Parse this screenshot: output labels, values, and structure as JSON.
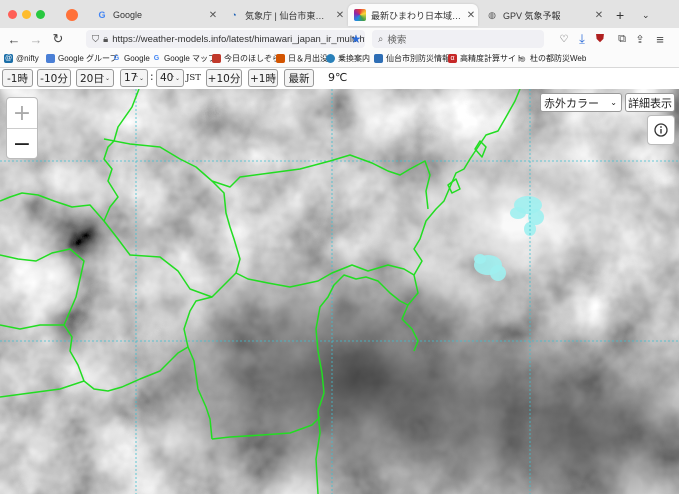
{
  "browser": {
    "tabs": [
      {
        "label": "",
        "icon": "firefox-icon"
      },
      {
        "label": "Google",
        "icon": "google-icon"
      },
      {
        "label": "気象庁 | 仙台市東部の防災情報",
        "icon": "weather-agency-icon"
      },
      {
        "label": "最新ひまわり日本域赤外 - Weath",
        "icon": "weather-models-icon"
      },
      {
        "label": "GPV 気象予報",
        "icon": "globe-icon"
      }
    ],
    "url": "https://weather-models.info/latest/himawari_japan_ir_multi.ht",
    "search_placeholder": "検索",
    "bookmarks": [
      {
        "label": "@nifty",
        "color": "#1a6ea8"
      },
      {
        "label": "Google グループ",
        "color": "#4a7fd6"
      },
      {
        "label": "Google",
        "color": "#e04b3c"
      },
      {
        "label": "Google マップ",
        "color": "#34a853"
      },
      {
        "label": "今日のほしぞら",
        "color": "#c0392b"
      },
      {
        "label": "日＆月出没",
        "color": "#d35400"
      },
      {
        "label": "乗換案内",
        "color": "#2980b9"
      },
      {
        "label": "仙台市別防災情報",
        "color": "#2e6eb5"
      },
      {
        "label": "高精度計算サイト",
        "color": "#c62828"
      },
      {
        "label": "杜の都防災Web",
        "color": "#555555"
      }
    ]
  },
  "controls": {
    "minus1h": "-1時",
    "minus10m": "-10分",
    "day": "20日",
    "hour": "17",
    "colon": ":",
    "minute": "40",
    "tz": "JST",
    "plus10m": "+10分",
    "plus1h": "+1時",
    "latest": "最新",
    "temperature": "9℃"
  },
  "map": {
    "zoom_in": "+",
    "zoom_out": "−",
    "color_mode": "赤外カラー",
    "detail": "詳細表示",
    "colors": {
      "coast": "#22dd22",
      "grid": "#3fbfcf",
      "cold_cloud": "#9ff0f0"
    }
  }
}
